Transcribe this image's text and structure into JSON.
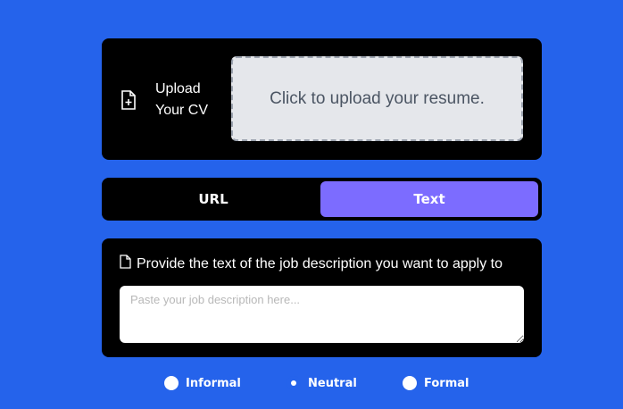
{
  "upload": {
    "label": "Upload\nYour CV",
    "dropzone_text": "Click to upload your resume."
  },
  "toggle": {
    "options": [
      {
        "label": "URL",
        "selected": false
      },
      {
        "label": "Text",
        "selected": true
      }
    ]
  },
  "description": {
    "title": "Provide the text of the job description you want to apply to",
    "placeholder": "Paste your job description here..."
  },
  "tone": {
    "options": [
      {
        "label": "Informal",
        "selected": false
      },
      {
        "label": "Neutral",
        "selected": true
      },
      {
        "label": "Formal",
        "selected": false
      }
    ]
  },
  "colors": {
    "background": "#2563eb",
    "accent": "#7c6cff"
  }
}
